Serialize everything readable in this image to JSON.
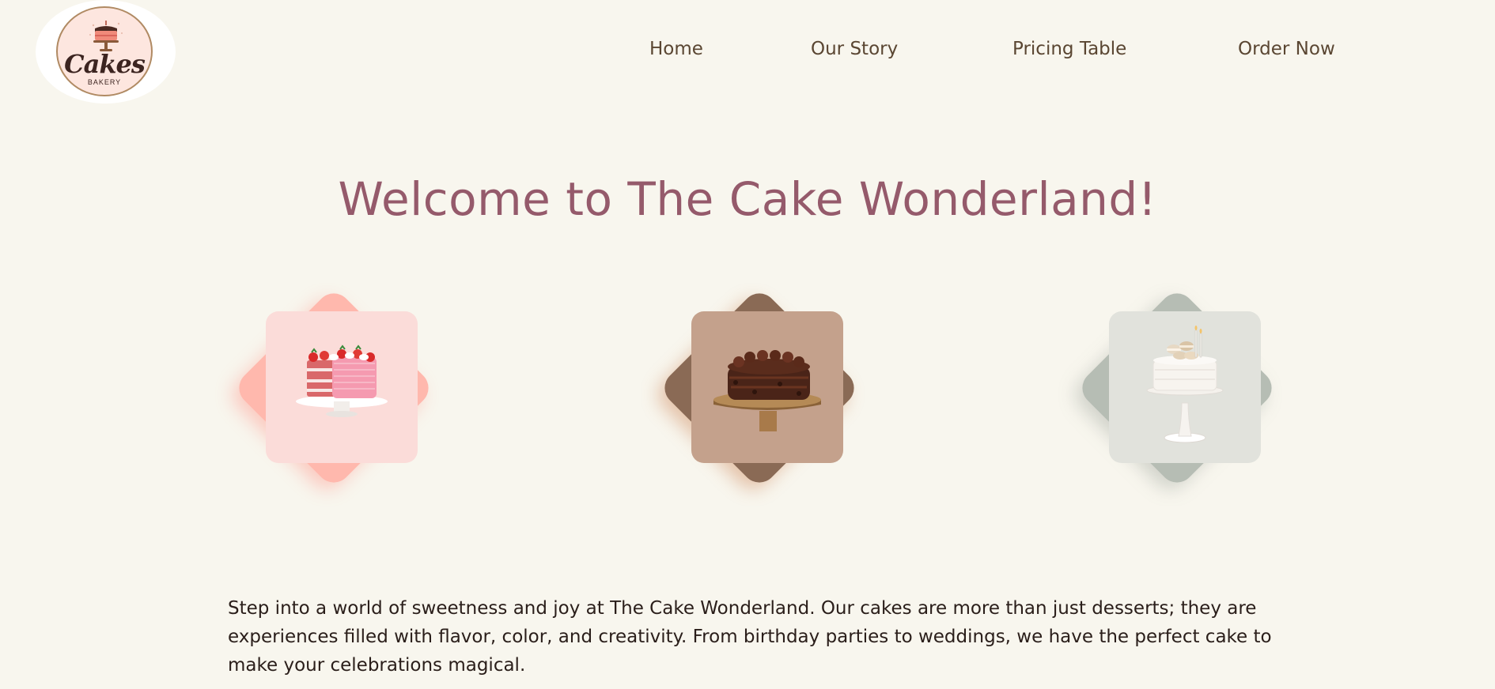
{
  "logo": {
    "word": "Cakes",
    "sub": "BAKERY",
    "icon": "cake-icon"
  },
  "nav": {
    "items": [
      {
        "label": "Home"
      },
      {
        "label": "Our Story"
      },
      {
        "label": "Pricing Table"
      },
      {
        "label": "Order Now"
      }
    ]
  },
  "hero": {
    "title": "Welcome to The Cake Wonderland!"
  },
  "cakes": [
    {
      "name": "strawberry-cake",
      "accent": "#ffb8ad",
      "tile": "#fbdcd9"
    },
    {
      "name": "chocolate-cake",
      "accent": "#8a6a55",
      "tile": "#c4a18c"
    },
    {
      "name": "white-macaron-cake",
      "accent": "#b6bdb4",
      "tile": "#e1e2dc"
    }
  ],
  "intro": {
    "text": "Step into a world of sweetness and joy at The Cake Wonderland. Our cakes are more than just desserts; they are experiences filled with flavor, color, and creativity. From birthday parties to weddings, we have the perfect cake to make your celebrations magical."
  },
  "colors": {
    "background": "#f8f6ee",
    "title": "#955a6b",
    "nav": "#5a4632"
  }
}
